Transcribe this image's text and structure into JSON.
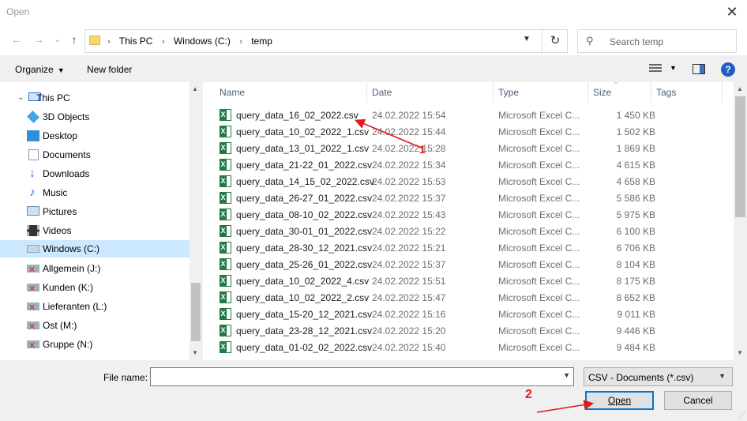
{
  "window": {
    "title": "Open",
    "close_glyph": "✕"
  },
  "nav": {
    "back": "←",
    "forward": "→",
    "recent": "⌄",
    "up": "↑",
    "breadcrumbs": [
      "This PC",
      "Windows (C:)",
      "temp"
    ],
    "separator": "›",
    "search_placeholder": "Search temp"
  },
  "toolbar": {
    "organize": "Organize",
    "new_folder": "New folder",
    "help": "?"
  },
  "sidebar": {
    "items": [
      {
        "label": "This PC",
        "icon": "computer-icon"
      },
      {
        "label": "3D Objects",
        "icon": "3d-objects-icon"
      },
      {
        "label": "Desktop",
        "icon": "desktop-icon"
      },
      {
        "label": "Documents",
        "icon": "documents-icon"
      },
      {
        "label": "Downloads",
        "icon": "downloads-icon"
      },
      {
        "label": "Music",
        "icon": "music-icon"
      },
      {
        "label": "Pictures",
        "icon": "pictures-icon"
      },
      {
        "label": "Videos",
        "icon": "videos-icon"
      },
      {
        "label": "Windows (C:)",
        "icon": "drive-icon",
        "selected": true
      },
      {
        "label": "Allgemein (J:)",
        "icon": "disconnected-drive-icon"
      },
      {
        "label": "Kunden (K:)",
        "icon": "disconnected-drive-icon"
      },
      {
        "label": "Lieferanten (L:)",
        "icon": "disconnected-drive-icon"
      },
      {
        "label": "Ost (M:)",
        "icon": "disconnected-drive-icon"
      },
      {
        "label": "Gruppe (N:)",
        "icon": "disconnected-drive-icon"
      }
    ]
  },
  "columns": {
    "name": "Name",
    "date": "Date",
    "type": "Type",
    "size": "Size",
    "tags": "Tags"
  },
  "files": [
    {
      "name": "query_data_16_02_2022.csv",
      "date": "24.02.2022 15:54",
      "type": "Microsoft Excel C...",
      "size": "1 450 KB"
    },
    {
      "name": "query_data_10_02_2022_1.csv",
      "date": "24.02.2022 15:44",
      "type": "Microsoft Excel C...",
      "size": "1 502 KB"
    },
    {
      "name": "query_data_13_01_2022_1.csv",
      "date": "24.02.2022 15:28",
      "type": "Microsoft Excel C...",
      "size": "1 869 KB"
    },
    {
      "name": "query_data_21-22_01_2022.csv",
      "date": "24.02.2022 15:34",
      "type": "Microsoft Excel C...",
      "size": "4 615 KB"
    },
    {
      "name": "query_data_14_15_02_2022.csv",
      "date": "24.02.2022 15:53",
      "type": "Microsoft Excel C...",
      "size": "4 658 KB"
    },
    {
      "name": "query_data_26-27_01_2022.csv",
      "date": "24.02.2022 15:37",
      "type": "Microsoft Excel C...",
      "size": "5 586 KB"
    },
    {
      "name": "query_data_08-10_02_2022.csv",
      "date": "24.02.2022 15:43",
      "type": "Microsoft Excel C...",
      "size": "5 975 KB"
    },
    {
      "name": "query_data_30-01_01_2022.csv",
      "date": "24.02.2022 15:22",
      "type": "Microsoft Excel C...",
      "size": "6 100 KB"
    },
    {
      "name": "query_data_28-30_12_2021.csv",
      "date": "24.02.2022 15:21",
      "type": "Microsoft Excel C...",
      "size": "6 706 KB"
    },
    {
      "name": "query_data_25-26_01_2022.csv",
      "date": "24.02.2022 15:37",
      "type": "Microsoft Excel C...",
      "size": "8 104 KB"
    },
    {
      "name": "query_data_10_02_2022_4.csv",
      "date": "24.02.2022 15:51",
      "type": "Microsoft Excel C...",
      "size": "8 175 KB"
    },
    {
      "name": "query_data_10_02_2022_2.csv",
      "date": "24.02.2022 15:47",
      "type": "Microsoft Excel C...",
      "size": "8 652 KB"
    },
    {
      "name": "query_data_15-20_12_2021.csv",
      "date": "24.02.2022 15:16",
      "type": "Microsoft Excel C...",
      "size": "9 011 KB"
    },
    {
      "name": "query_data_23-28_12_2021.csv",
      "date": "24.02.2022 15:20",
      "type": "Microsoft Excel C...",
      "size": "9 446 KB"
    },
    {
      "name": "query_data_01-02_02_2022.csv",
      "date": "24.02.2022 15:40",
      "type": "Microsoft Excel C...",
      "size": "9 484 KB"
    }
  ],
  "bottom": {
    "file_name_label": "File name:",
    "file_name_value": "",
    "filter": "CSV - Documents (*.csv)",
    "open": "Open",
    "cancel": "Cancel"
  },
  "annotations": {
    "step1": "1",
    "step2": "2",
    "color": "#e01b1b"
  }
}
